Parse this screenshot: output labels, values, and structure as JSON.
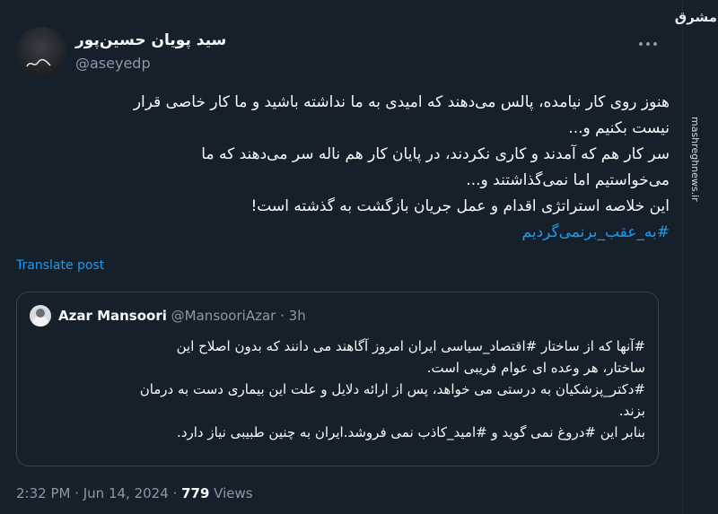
{
  "tweet": {
    "display_name": "سید پویان حسین‌پور",
    "handle": "@aseyedp",
    "lines": [
      "هنوز روی کار نیامده، پالس می‌دهند که امیدی به ما نداشته باشید و ما کار خاصی قرار",
      "نیست بکنیم و...",
      "سر کار هم که آمدند و کاری نکردند، در پایان کار هم ناله سر می‌دهند که ما",
      "می‌خواستیم اما نمی‌گذاشتند و...",
      "این خلاصه استراتژی اقدام و عمل جریان بازگشت به گذشته است!"
    ],
    "hashtag": "#به_عقب_برنمی‌گردیم",
    "translate_label": "Translate post",
    "timestamp": "2:32 PM · Jun 14, 2024 ·",
    "views_count": "779",
    "views_label": "Views"
  },
  "quote": {
    "name": "Azar Mansoori",
    "handle": "@MansooriAzar",
    "dot": "·",
    "time": "3h",
    "lines": [
      "#آنها که از ساختار #اقتصاد_سیاسی ایران امروز آگاهند می دانند که بدون اصلاح این",
      "ساختار، هر وعده ای عوام فریبی است.",
      "#دکتر_پزشکیان به درستی می خواهد، پس از ارائه دلایل و علت این بیماری دست به درمان",
      "بزند.",
      "بنابر این #دروغ نمی گوید و #امید_کاذب نمی فروشد.ایران به چنین طبیبی نیاز دارد."
    ]
  },
  "watermark": {
    "logo": "مشرق",
    "url": "mashreghnews.ir"
  },
  "colors": {
    "background": "#15202b",
    "accent": "#1d9bf0",
    "secondary_text": "#8b98a5",
    "border": "#38444d"
  },
  "icons": {
    "more": "more-horizontal-icon"
  }
}
